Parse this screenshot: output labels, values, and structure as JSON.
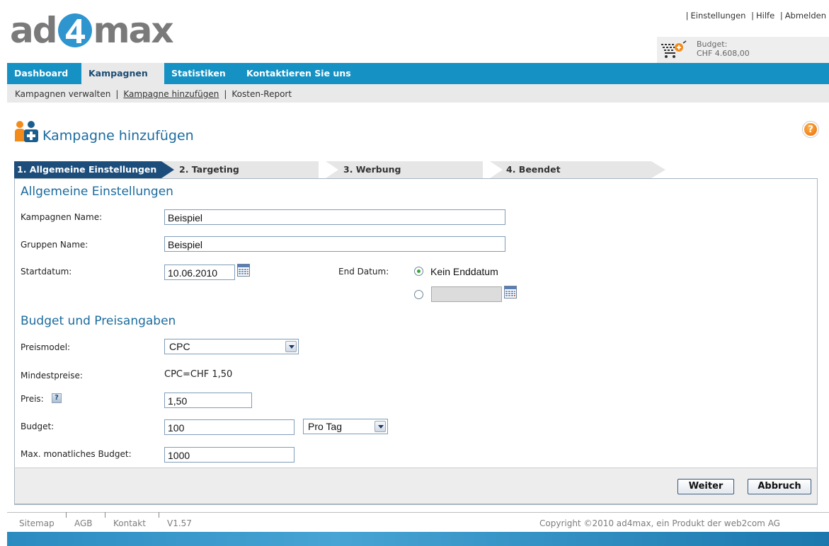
{
  "brand": {
    "logo_left": "ad",
    "logo_digit": "4",
    "logo_right": "max"
  },
  "top_links": [
    "Einstellungen",
    "Hilfe",
    "Abmelden"
  ],
  "budget_box": {
    "label": "Budget:",
    "value": "CHF 4.608,00"
  },
  "main_nav": [
    "Dashboard",
    "Kampagnen",
    "Statistiken",
    "Kontaktieren Sie uns"
  ],
  "main_nav_active": "Kampagnen",
  "sub_nav": [
    "Kampagnen verwalten",
    "Kampagne hinzufügen",
    "Kosten-Report"
  ],
  "page_title": "Kampagne hinzufügen",
  "steps": [
    "1. Allgemeine Einstellungen",
    "2. Targeting",
    "3. Werbung",
    "4. Beendet"
  ],
  "active_step": "1. Allgemeine Einstellungen",
  "section_general": {
    "heading": "Allgemeine Einstellungen",
    "campaign_name_label": "Kampagnen Name:",
    "campaign_name_value": "Beispiel",
    "group_name_label": "Gruppen Name:",
    "group_name_value": "Beispiel",
    "start_date_label": "Startdatum:",
    "start_date_value": "10.06.2010",
    "end_date_label": "End Datum:",
    "no_end_date_label": "Kein Enddatum",
    "no_end_date_selected": true,
    "end_date_value": ""
  },
  "section_budget": {
    "heading": "Budget und Preisangaben",
    "pricing_model_label": "Preismodel:",
    "pricing_model_value": "CPC",
    "min_price_label": "Mindestpreise:",
    "min_price_value": "CPC=CHF 1,50",
    "price_label": "Preis:",
    "price_value": "1,50",
    "budget_label": "Budget:",
    "budget_value": "100",
    "budget_period_value": "Pro Tag",
    "max_monthly_label": "Max. monatliches Budget:",
    "max_monthly_value": "1000"
  },
  "buttons": {
    "next": "Weiter",
    "cancel": "Abbruch"
  },
  "footer": {
    "links": [
      "Sitemap",
      "AGB",
      "Kontakt",
      "V1.57"
    ],
    "copyright": "Copyright ©2010 ad4max, ein Produkt der web2com AG"
  },
  "colors": {
    "nav": "#1591c3",
    "heading": "#1b6b9e",
    "step_active": "#1d4d7a",
    "accent_orange": "#f28a1c"
  },
  "icons": {
    "help": "help-icon",
    "calendar": "calendar-icon",
    "cart": "cart-icon",
    "user_add": "user-add-icon"
  }
}
